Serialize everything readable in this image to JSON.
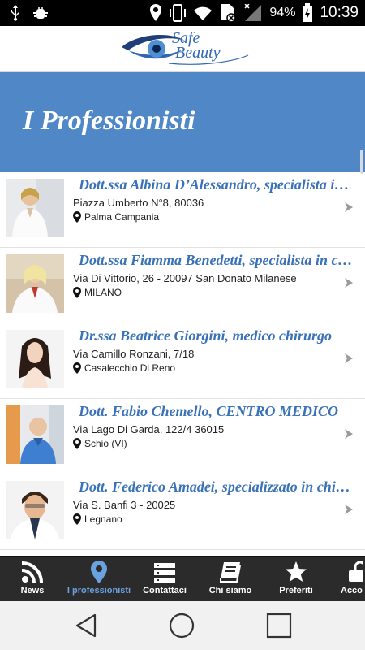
{
  "status_bar": {
    "battery": "94%",
    "time": "10:39",
    "icons": [
      "usb-icon",
      "android-debug-icon",
      "location-icon",
      "phone-vibrate-icon",
      "wifi-icon",
      "no-sim-icon",
      "signal-icon",
      "battery-charging-icon"
    ]
  },
  "header": {
    "logo_line1": "Safe",
    "logo_line2": "Beauty"
  },
  "hero": {
    "title": "I Professionisti"
  },
  "list": {
    "items": [
      {
        "title": "Dott.ssa Albina D’Alessandro, specialista in dermatologia",
        "address": "Piazza Umberto N°8, 80036",
        "city": "Palma Campania"
      },
      {
        "title": "Dott.ssa Fiamma Benedetti, specialista in chirurgia",
        "address": "Via Di Vittorio, 26 - 20097 San Donato Milanese",
        "city": "MILANO"
      },
      {
        "title": "Dr.ssa  Beatrice Giorgini, medico chirurgo",
        "address": "Via Camillo Ronzani, 7/18",
        "city": "Casalecchio Di Reno"
      },
      {
        "title": "Dott. Fabio Chemello, CENTRO MEDICO",
        "address": "Via Lago Di Garda, 122/4 36015",
        "city": "Schio (VI)"
      },
      {
        "title": "Dott. Federico Amadei, specializzato in chirurgia",
        "address": "Via S. Banfi 3 - 20025",
        "city": "Legnano"
      }
    ]
  },
  "tabs": [
    {
      "label": "News",
      "icon": "rss-icon"
    },
    {
      "label": "I professionisti",
      "icon": "map-pin-icon",
      "active": true
    },
    {
      "label": "Contattaci",
      "icon": "list-icon"
    },
    {
      "label": "Chi siamo",
      "icon": "book-icon"
    },
    {
      "label": "Preferiti",
      "icon": "star-icon"
    },
    {
      "label": "Acco",
      "icon": "lock-icon"
    }
  ],
  "colors": {
    "hero": "#5088c7",
    "accent": "#3a72b8",
    "tab_active": "#6aa2e0",
    "tab_bar": "#2b2b2b"
  }
}
